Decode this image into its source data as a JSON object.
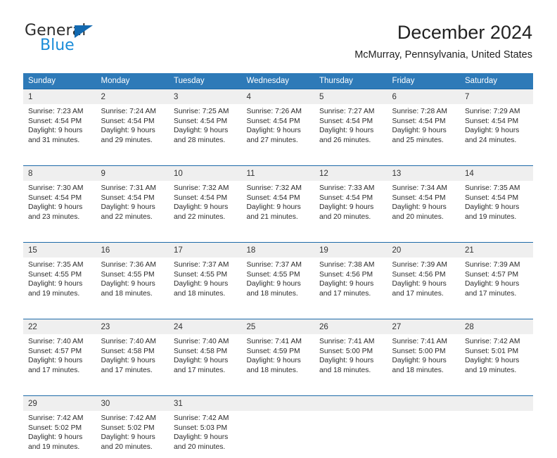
{
  "brand": {
    "name_top": "General",
    "name_bottom": "Blue",
    "triangle_color": "#1269b0",
    "blue_color": "#1a8cd8"
  },
  "header": {
    "title": "December 2024",
    "subtitle": "McMurray, Pennsylvania, United States"
  },
  "theme": {
    "header_bg": "#2e7ab8",
    "header_text": "#ffffff",
    "daynum_bg": "#efefef",
    "row_rule": "#1d6aa8"
  },
  "weekday_headers": [
    "Sunday",
    "Monday",
    "Tuesday",
    "Wednesday",
    "Thursday",
    "Friday",
    "Saturday"
  ],
  "weeks": [
    [
      {
        "day": "1",
        "sunrise": "Sunrise: 7:23 AM",
        "sunset": "Sunset: 4:54 PM",
        "daylight1": "Daylight: 9 hours",
        "daylight2": "and 31 minutes."
      },
      {
        "day": "2",
        "sunrise": "Sunrise: 7:24 AM",
        "sunset": "Sunset: 4:54 PM",
        "daylight1": "Daylight: 9 hours",
        "daylight2": "and 29 minutes."
      },
      {
        "day": "3",
        "sunrise": "Sunrise: 7:25 AM",
        "sunset": "Sunset: 4:54 PM",
        "daylight1": "Daylight: 9 hours",
        "daylight2": "and 28 minutes."
      },
      {
        "day": "4",
        "sunrise": "Sunrise: 7:26 AM",
        "sunset": "Sunset: 4:54 PM",
        "daylight1": "Daylight: 9 hours",
        "daylight2": "and 27 minutes."
      },
      {
        "day": "5",
        "sunrise": "Sunrise: 7:27 AM",
        "sunset": "Sunset: 4:54 PM",
        "daylight1": "Daylight: 9 hours",
        "daylight2": "and 26 minutes."
      },
      {
        "day": "6",
        "sunrise": "Sunrise: 7:28 AM",
        "sunset": "Sunset: 4:54 PM",
        "daylight1": "Daylight: 9 hours",
        "daylight2": "and 25 minutes."
      },
      {
        "day": "7",
        "sunrise": "Sunrise: 7:29 AM",
        "sunset": "Sunset: 4:54 PM",
        "daylight1": "Daylight: 9 hours",
        "daylight2": "and 24 minutes."
      }
    ],
    [
      {
        "day": "8",
        "sunrise": "Sunrise: 7:30 AM",
        "sunset": "Sunset: 4:54 PM",
        "daylight1": "Daylight: 9 hours",
        "daylight2": "and 23 minutes."
      },
      {
        "day": "9",
        "sunrise": "Sunrise: 7:31 AM",
        "sunset": "Sunset: 4:54 PM",
        "daylight1": "Daylight: 9 hours",
        "daylight2": "and 22 minutes."
      },
      {
        "day": "10",
        "sunrise": "Sunrise: 7:32 AM",
        "sunset": "Sunset: 4:54 PM",
        "daylight1": "Daylight: 9 hours",
        "daylight2": "and 22 minutes."
      },
      {
        "day": "11",
        "sunrise": "Sunrise: 7:32 AM",
        "sunset": "Sunset: 4:54 PM",
        "daylight1": "Daylight: 9 hours",
        "daylight2": "and 21 minutes."
      },
      {
        "day": "12",
        "sunrise": "Sunrise: 7:33 AM",
        "sunset": "Sunset: 4:54 PM",
        "daylight1": "Daylight: 9 hours",
        "daylight2": "and 20 minutes."
      },
      {
        "day": "13",
        "sunrise": "Sunrise: 7:34 AM",
        "sunset": "Sunset: 4:54 PM",
        "daylight1": "Daylight: 9 hours",
        "daylight2": "and 20 minutes."
      },
      {
        "day": "14",
        "sunrise": "Sunrise: 7:35 AM",
        "sunset": "Sunset: 4:54 PM",
        "daylight1": "Daylight: 9 hours",
        "daylight2": "and 19 minutes."
      }
    ],
    [
      {
        "day": "15",
        "sunrise": "Sunrise: 7:35 AM",
        "sunset": "Sunset: 4:55 PM",
        "daylight1": "Daylight: 9 hours",
        "daylight2": "and 19 minutes."
      },
      {
        "day": "16",
        "sunrise": "Sunrise: 7:36 AM",
        "sunset": "Sunset: 4:55 PM",
        "daylight1": "Daylight: 9 hours",
        "daylight2": "and 18 minutes."
      },
      {
        "day": "17",
        "sunrise": "Sunrise: 7:37 AM",
        "sunset": "Sunset: 4:55 PM",
        "daylight1": "Daylight: 9 hours",
        "daylight2": "and 18 minutes."
      },
      {
        "day": "18",
        "sunrise": "Sunrise: 7:37 AM",
        "sunset": "Sunset: 4:55 PM",
        "daylight1": "Daylight: 9 hours",
        "daylight2": "and 18 minutes."
      },
      {
        "day": "19",
        "sunrise": "Sunrise: 7:38 AM",
        "sunset": "Sunset: 4:56 PM",
        "daylight1": "Daylight: 9 hours",
        "daylight2": "and 17 minutes."
      },
      {
        "day": "20",
        "sunrise": "Sunrise: 7:39 AM",
        "sunset": "Sunset: 4:56 PM",
        "daylight1": "Daylight: 9 hours",
        "daylight2": "and 17 minutes."
      },
      {
        "day": "21",
        "sunrise": "Sunrise: 7:39 AM",
        "sunset": "Sunset: 4:57 PM",
        "daylight1": "Daylight: 9 hours",
        "daylight2": "and 17 minutes."
      }
    ],
    [
      {
        "day": "22",
        "sunrise": "Sunrise: 7:40 AM",
        "sunset": "Sunset: 4:57 PM",
        "daylight1": "Daylight: 9 hours",
        "daylight2": "and 17 minutes."
      },
      {
        "day": "23",
        "sunrise": "Sunrise: 7:40 AM",
        "sunset": "Sunset: 4:58 PM",
        "daylight1": "Daylight: 9 hours",
        "daylight2": "and 17 minutes."
      },
      {
        "day": "24",
        "sunrise": "Sunrise: 7:40 AM",
        "sunset": "Sunset: 4:58 PM",
        "daylight1": "Daylight: 9 hours",
        "daylight2": "and 17 minutes."
      },
      {
        "day": "25",
        "sunrise": "Sunrise: 7:41 AM",
        "sunset": "Sunset: 4:59 PM",
        "daylight1": "Daylight: 9 hours",
        "daylight2": "and 18 minutes."
      },
      {
        "day": "26",
        "sunrise": "Sunrise: 7:41 AM",
        "sunset": "Sunset: 5:00 PM",
        "daylight1": "Daylight: 9 hours",
        "daylight2": "and 18 minutes."
      },
      {
        "day": "27",
        "sunrise": "Sunrise: 7:41 AM",
        "sunset": "Sunset: 5:00 PM",
        "daylight1": "Daylight: 9 hours",
        "daylight2": "and 18 minutes."
      },
      {
        "day": "28",
        "sunrise": "Sunrise: 7:42 AM",
        "sunset": "Sunset: 5:01 PM",
        "daylight1": "Daylight: 9 hours",
        "daylight2": "and 19 minutes."
      }
    ],
    [
      {
        "day": "29",
        "sunrise": "Sunrise: 7:42 AM",
        "sunset": "Sunset: 5:02 PM",
        "daylight1": "Daylight: 9 hours",
        "daylight2": "and 19 minutes."
      },
      {
        "day": "30",
        "sunrise": "Sunrise: 7:42 AM",
        "sunset": "Sunset: 5:02 PM",
        "daylight1": "Daylight: 9 hours",
        "daylight2": "and 20 minutes."
      },
      {
        "day": "31",
        "sunrise": "Sunrise: 7:42 AM",
        "sunset": "Sunset: 5:03 PM",
        "daylight1": "Daylight: 9 hours",
        "daylight2": "and 20 minutes."
      },
      {
        "day": "",
        "sunrise": "",
        "sunset": "",
        "daylight1": "",
        "daylight2": ""
      },
      {
        "day": "",
        "sunrise": "",
        "sunset": "",
        "daylight1": "",
        "daylight2": ""
      },
      {
        "day": "",
        "sunrise": "",
        "sunset": "",
        "daylight1": "",
        "daylight2": ""
      },
      {
        "day": "",
        "sunrise": "",
        "sunset": "",
        "daylight1": "",
        "daylight2": ""
      }
    ]
  ]
}
